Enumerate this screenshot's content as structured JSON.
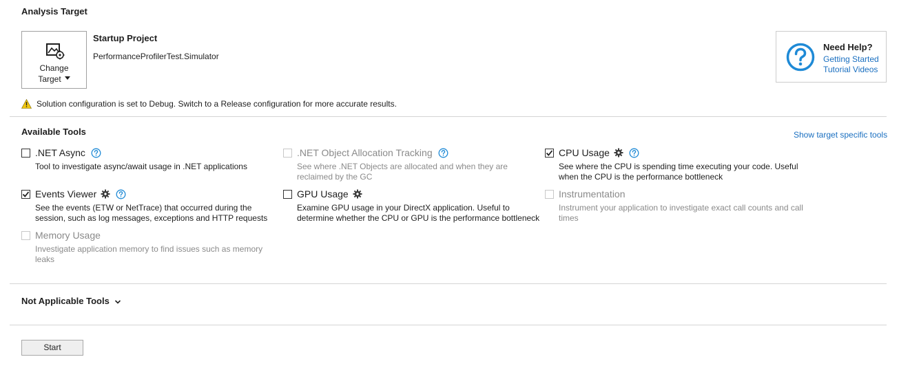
{
  "analysis_target": {
    "title": "Analysis Target",
    "change_target_line1": "Change",
    "change_target_line2": "Target",
    "startup_label": "Startup Project",
    "startup_value": "PerformanceProfilerTest.Simulator",
    "warning": "Solution configuration is set to Debug. Switch to a Release configuration for more accurate results."
  },
  "help": {
    "title": "Need Help?",
    "link1": "Getting Started",
    "link2": "Tutorial Videos"
  },
  "available_tools": {
    "title": "Available Tools",
    "show_target_link": "Show target specific tools",
    "tools": [
      {
        "name": ".NET Async",
        "description": "Tool to investigate async/await usage in .NET applications",
        "checked": false,
        "enabled": true
      },
      {
        "name": ".NET Object Allocation Tracking",
        "description": "See where .NET Objects are allocated and when they are reclaimed by the GC",
        "checked": false,
        "enabled": false
      },
      {
        "name": "CPU Usage",
        "description": "See where the CPU is spending time executing your code. Useful when the CPU is the performance bottleneck",
        "checked": true,
        "enabled": true
      },
      {
        "name": "Events Viewer",
        "description": "See the events (ETW or NetTrace) that occurred during the session, such as log messages, exceptions and HTTP requests",
        "checked": true,
        "enabled": true
      },
      {
        "name": "GPU Usage",
        "description": "Examine GPU usage in your DirectX application. Useful to determine whether the CPU or GPU is the performance bottleneck",
        "checked": false,
        "enabled": true
      },
      {
        "name": "Instrumentation",
        "description": "Instrument your application to investigate exact call counts and call times",
        "checked": false,
        "enabled": false
      },
      {
        "name": "Memory Usage",
        "description": "Investigate application memory to find issues such as memory leaks",
        "checked": false,
        "enabled": false
      }
    ]
  },
  "not_applicable": {
    "title": "Not Applicable Tools"
  },
  "start_label": "Start",
  "colors": {
    "link": "#1a6fc0",
    "help_icon": "#1f8ad6",
    "warning": "#f2c80f",
    "disabled_text": "#8a8a8a"
  }
}
